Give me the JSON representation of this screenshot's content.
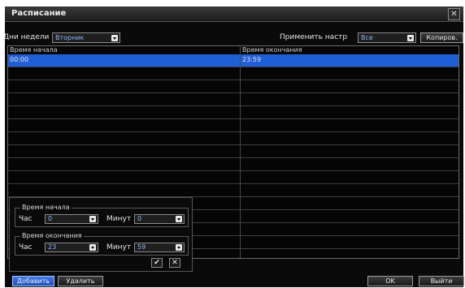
{
  "window": {
    "title": "Расписание",
    "close_glyph": "✕"
  },
  "toolbar": {
    "days_label": "Дни недели",
    "day_value": "Вторник",
    "apply_label": "Применить настр",
    "apply_value": "Все",
    "copy_label": "Копиров."
  },
  "table": {
    "headers": [
      "Время начала",
      "Время окончания"
    ],
    "rows": [
      {
        "start": "00:00",
        "end": "23:59"
      }
    ]
  },
  "editor": {
    "start_legend": "Время начала",
    "end_legend": "Время окончания",
    "hour_label": "Час",
    "minute_label": "Минут",
    "start_hour": "0",
    "start_minute": "0",
    "end_hour": "23",
    "end_minute": "59",
    "confirm_glyph": "✔",
    "cancel_glyph": "✕"
  },
  "footer": {
    "add_label": "Добавить",
    "delete_label": "Удалить",
    "ok_label": "OK",
    "exit_label": "Выйти"
  },
  "colors": {
    "selected_row": "#1f5fd6",
    "value_text": "#8fb7ff",
    "window_bg": "#0a0a0a"
  }
}
